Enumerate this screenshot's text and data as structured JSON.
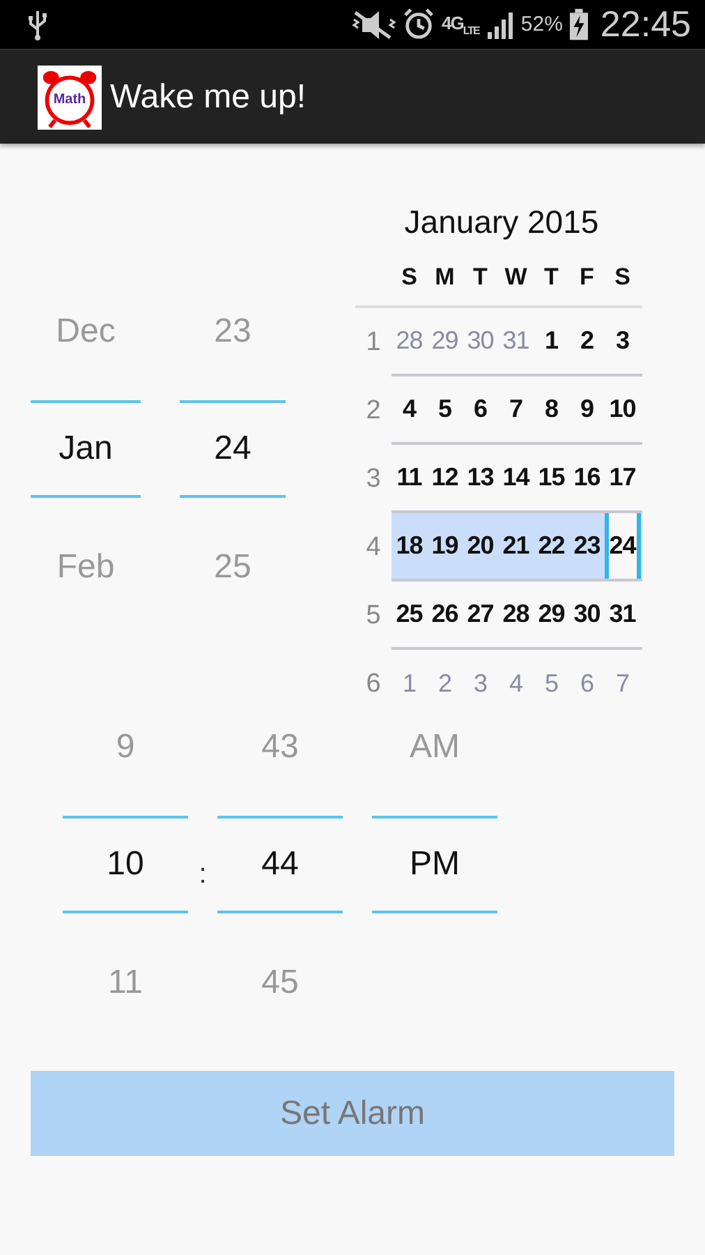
{
  "status_bar": {
    "network": "4G",
    "network_sub": "LTE",
    "battery_text": "52%",
    "time": "22:45"
  },
  "app_bar": {
    "logo_text": "Math",
    "title": "Wake me up!"
  },
  "date_picker": {
    "columns": [
      {
        "items": [
          {
            "text": "Dec",
            "selected": false
          },
          {
            "text": "Jan",
            "selected": true
          },
          {
            "text": "Feb",
            "selected": false
          }
        ]
      },
      {
        "items": [
          {
            "text": "23",
            "selected": false
          },
          {
            "text": "24",
            "selected": true
          },
          {
            "text": "25",
            "selected": false
          }
        ]
      }
    ]
  },
  "calendar": {
    "title": "January 2015",
    "weekdays": [
      "S",
      "M",
      "T",
      "W",
      "T",
      "F",
      "S"
    ],
    "weeks": [
      {
        "number": "1",
        "selected": false,
        "days": [
          {
            "text": "28",
            "in_month": false,
            "selected": false
          },
          {
            "text": "29",
            "in_month": false,
            "selected": false
          },
          {
            "text": "30",
            "in_month": false,
            "selected": false
          },
          {
            "text": "31",
            "in_month": false,
            "selected": false
          },
          {
            "text": "1",
            "in_month": true,
            "selected": false
          },
          {
            "text": "2",
            "in_month": true,
            "selected": false
          },
          {
            "text": "3",
            "in_month": true,
            "selected": false
          }
        ]
      },
      {
        "number": "2",
        "selected": false,
        "days": [
          {
            "text": "4",
            "in_month": true,
            "selected": false
          },
          {
            "text": "5",
            "in_month": true,
            "selected": false
          },
          {
            "text": "6",
            "in_month": true,
            "selected": false
          },
          {
            "text": "7",
            "in_month": true,
            "selected": false
          },
          {
            "text": "8",
            "in_month": true,
            "selected": false
          },
          {
            "text": "9",
            "in_month": true,
            "selected": false
          },
          {
            "text": "10",
            "in_month": true,
            "selected": false
          }
        ]
      },
      {
        "number": "3",
        "selected": false,
        "days": [
          {
            "text": "11",
            "in_month": true,
            "selected": false
          },
          {
            "text": "12",
            "in_month": true,
            "selected": false
          },
          {
            "text": "13",
            "in_month": true,
            "selected": false
          },
          {
            "text": "14",
            "in_month": true,
            "selected": false
          },
          {
            "text": "15",
            "in_month": true,
            "selected": false
          },
          {
            "text": "16",
            "in_month": true,
            "selected": false
          },
          {
            "text": "17",
            "in_month": true,
            "selected": false
          }
        ]
      },
      {
        "number": "4",
        "selected": true,
        "days": [
          {
            "text": "18",
            "in_month": true,
            "selected": false
          },
          {
            "text": "19",
            "in_month": true,
            "selected": false
          },
          {
            "text": "20",
            "in_month": true,
            "selected": false
          },
          {
            "text": "21",
            "in_month": true,
            "selected": false
          },
          {
            "text": "22",
            "in_month": true,
            "selected": false
          },
          {
            "text": "23",
            "in_month": true,
            "selected": false
          },
          {
            "text": "24",
            "in_month": true,
            "selected": true
          }
        ]
      },
      {
        "number": "5",
        "selected": false,
        "days": [
          {
            "text": "25",
            "in_month": true,
            "selected": false
          },
          {
            "text": "26",
            "in_month": true,
            "selected": false
          },
          {
            "text": "27",
            "in_month": true,
            "selected": false
          },
          {
            "text": "28",
            "in_month": true,
            "selected": false
          },
          {
            "text": "29",
            "in_month": true,
            "selected": false
          },
          {
            "text": "30",
            "in_month": true,
            "selected": false
          },
          {
            "text": "31",
            "in_month": true,
            "selected": false
          }
        ]
      },
      {
        "number": "6",
        "selected": false,
        "days": [
          {
            "text": "1",
            "in_month": false,
            "selected": false
          },
          {
            "text": "2",
            "in_month": false,
            "selected": false
          },
          {
            "text": "3",
            "in_month": false,
            "selected": false
          },
          {
            "text": "4",
            "in_month": false,
            "selected": false
          },
          {
            "text": "5",
            "in_month": false,
            "selected": false
          },
          {
            "text": "6",
            "in_month": false,
            "selected": false
          },
          {
            "text": "7",
            "in_month": false,
            "selected": false
          }
        ]
      }
    ]
  },
  "time_picker": {
    "separator": ":",
    "columns": [
      {
        "items": [
          {
            "text": "9",
            "selected": false
          },
          {
            "text": "10",
            "selected": true
          },
          {
            "text": "11",
            "selected": false
          }
        ]
      },
      {
        "items": [
          {
            "text": "43",
            "selected": false
          },
          {
            "text": "44",
            "selected": true
          },
          {
            "text": "45",
            "selected": false
          }
        ]
      },
      {
        "items": [
          {
            "text": "AM",
            "selected": false
          },
          {
            "text": "PM",
            "selected": true
          }
        ]
      }
    ]
  },
  "button": {
    "label": "Set Alarm",
    "disabled": true
  }
}
